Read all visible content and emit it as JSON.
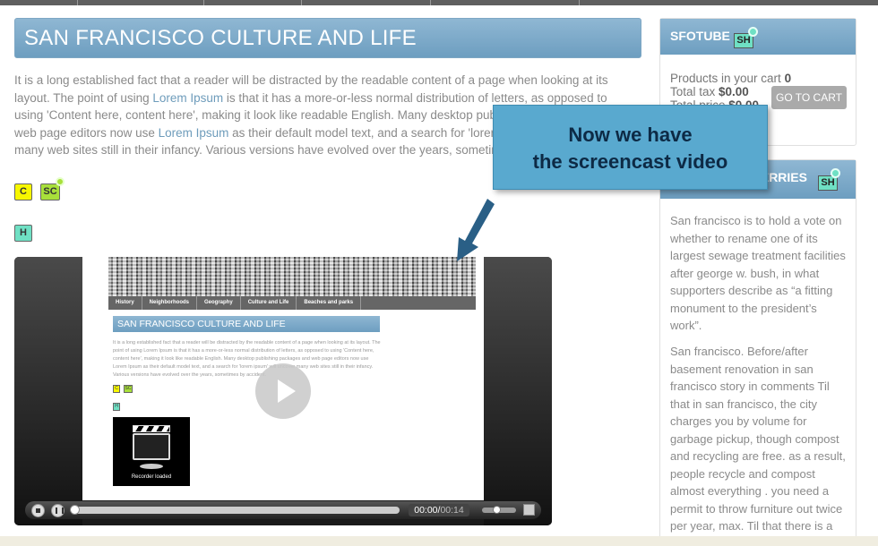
{
  "main": {
    "title": "SAN FRANCISCO CULTURE AND LIFE",
    "intro": {
      "t1": "It is a long established fact that a reader will be distracted by the readable content of a page when looking at its layout. The point of using ",
      "link1": "Lorem Ipsum",
      "t2": " is that it has a more-or-less normal distribution of letters, as opposed to using 'Content here, content here', making it look like readable English. Many desktop publishing packages and web page editors now use ",
      "link2": "Lorem Ipsum",
      "t3": " as their default model text, and a search for 'lorem ipsum' will uncover many web sites still in their infancy. Various versions have evolved over the years, sometimes by accident."
    },
    "buttons": {
      "c": "C",
      "sc": "SC",
      "h": "H"
    }
  },
  "video": {
    "nav": [
      "History",
      "Neighborhoods",
      "Geography",
      "Culture and Life",
      "Beaches and parks"
    ],
    "mini_title": "SAN FRANCISCO CULTURE AND LIFE",
    "mini_text": "It is a long established fact that a reader will be distracted by the readable content of a page when looking at its layout. The point of using Lorem Ipsum is that it has a more-or-less normal distribution of letters, as opposed to using 'Content here, content here', making it look like readable English. Many desktop publishing packages and web page editors now use Lorem Ipsum as their default model text, and a search for 'lorem ipsum' will uncover many web sites still in their infancy. Various versions have evolved over the years, sometimes by accident.",
    "clapper_caption": "Recorder loaded",
    "time_current": "00:00/",
    "time_total": "00:14"
  },
  "callout": {
    "line1": "Now we have",
    "line2": "the screencast video"
  },
  "sidebar": {
    "cart": {
      "title": "SFOTUBE",
      "badge": "SH",
      "products_label": "Products in your cart ",
      "products_value": "0",
      "tax_label": "Total tax ",
      "tax_value": "$0.00",
      "price_label": "Total price ",
      "price_value": "$0.00",
      "button": "GO TO CART"
    },
    "berries": {
      "title": "THE CITY OF BERRIES",
      "badge": "SH",
      "p1": "San francisco is to hold a vote on whether to rename one of its largest sewage treatment facilities after george w. bush, in what supporters describe as “a fitting monument to the president’s work”.",
      "p2": "San francisco. Before/after basement renovation in san francisco story in comments Til that in san francisco, the city charges you by volume for garbage pickup, though compost and recycling are free. as a result, people recycle and compost almost everything . you need a permit to throw furniture out twice per year, max. Til that there is a"
    }
  },
  "colors": {
    "accent_blue": "#6d9ec0",
    "callout_blue": "#59a9cf",
    "c_yellow": "#f7f700",
    "sc_green": "#a8e03a",
    "h_teal": "#6fe0c4"
  }
}
